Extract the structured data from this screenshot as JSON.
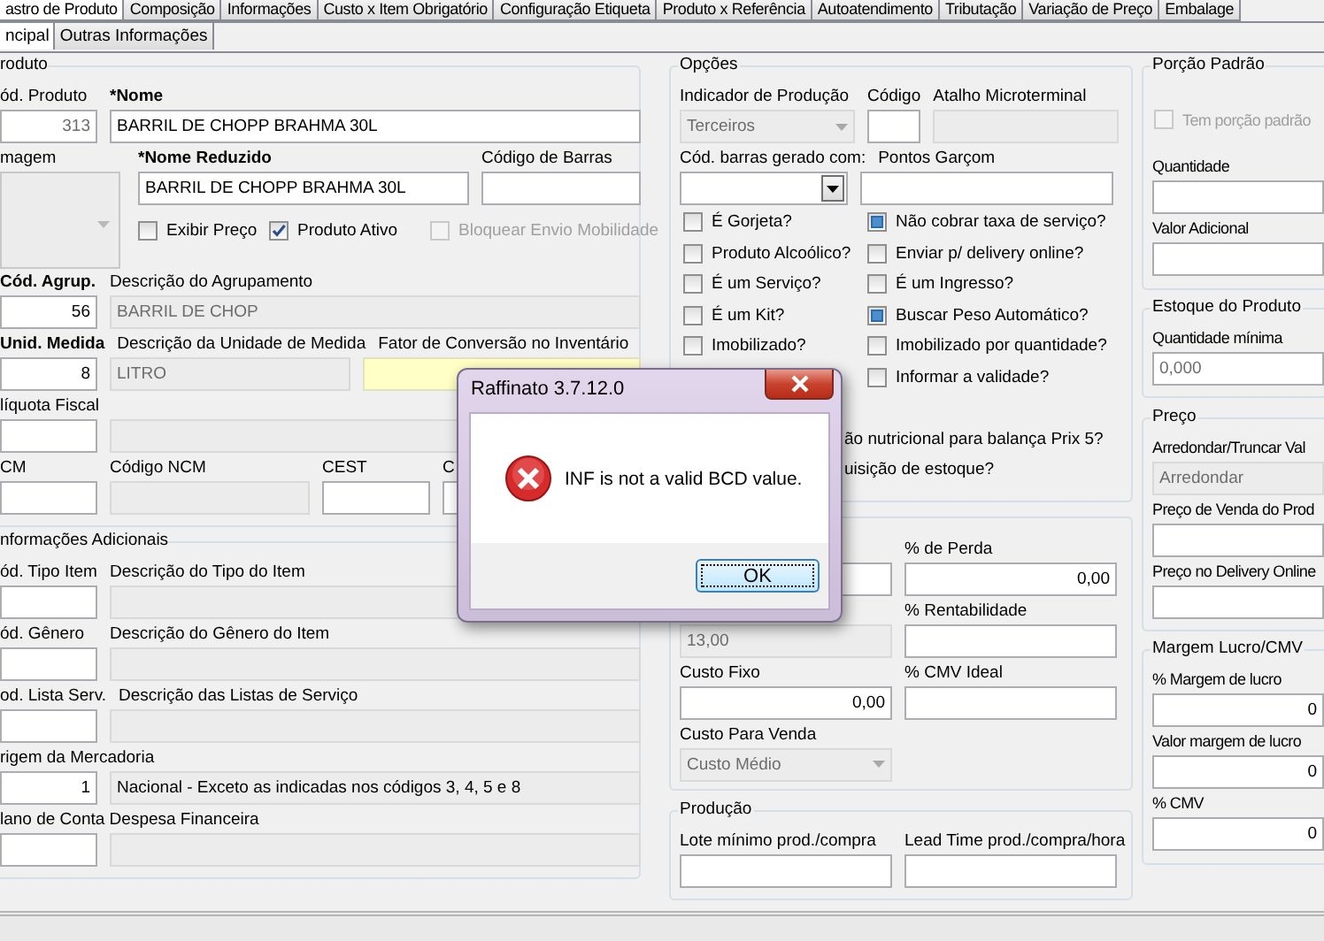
{
  "tabs": [
    {
      "label": "astro de Produto",
      "selected": true
    },
    {
      "label": "Composição",
      "selected": false
    },
    {
      "label": "Informações",
      "selected": false
    },
    {
      "label": "Custo x Item Obrigatório",
      "selected": false
    },
    {
      "label": "Configuração Etiqueta",
      "selected": false
    },
    {
      "label": "Produto x Referência",
      "selected": false
    },
    {
      "label": "Autoatendimento",
      "selected": false
    },
    {
      "label": "Tributação",
      "selected": false
    },
    {
      "label": "Variação de Preço",
      "selected": false
    },
    {
      "label": "Embalage",
      "selected": false
    }
  ],
  "subtabs": [
    {
      "label": "ncipal",
      "selected": true
    },
    {
      "label": "Outras Informações",
      "selected": false
    }
  ],
  "produto": {
    "title": "roduto",
    "cod": {
      "label": "ód. Produto",
      "value": "313"
    },
    "nome": {
      "label": "*Nome",
      "value": "BARRIL DE CHOPP BRAHMA 30L",
      "required": true
    },
    "imagem": {
      "label": "magem"
    },
    "nome_reduzido": {
      "label": "*Nome Reduzido",
      "value": "BARRIL DE CHOPP BRAHMA 30L",
      "required": true
    },
    "codigo_barras": {
      "label": "Código de Barras"
    },
    "checks": [
      {
        "label": "Exibir Preço",
        "checked": false,
        "disabled": false
      },
      {
        "label": "Produto Ativo",
        "checked": true,
        "disabled": false
      },
      {
        "label": "Bloquear Envio Mobilidade",
        "checked": false,
        "disabled": true
      }
    ],
    "agrup": {
      "label": "Cód. Agrup.",
      "value": "56",
      "required": true
    },
    "agrup_desc": {
      "label": "Descrição do Agrupamento",
      "value": "BARRIL DE CHOP",
      "disabled": true
    },
    "unid": {
      "label": "Unid. Medida",
      "value": "8",
      "required": true
    },
    "unid_desc": {
      "label": "Descrição da Unidade de Medida",
      "value": "LITRO",
      "disabled": true
    },
    "fator": {
      "label": "Fator de Conversão no Inventário",
      "highlighted": true
    },
    "aliquota": {
      "label": "líquota Fiscal"
    },
    "aliquota_desc": {
      "disabled": true
    },
    "ncm": [
      {
        "label": "CM",
        "disabled": false
      },
      {
        "label": "Código NCM",
        "disabled": true
      },
      {
        "label": "CEST",
        "disabled": false
      },
      {
        "label": "C",
        "disabled": false
      }
    ]
  },
  "adicionais": {
    "title": "nformações Adicionais",
    "rows": [
      {
        "code_label": "ód. Tipo Item",
        "desc_label": "Descrição do Tipo do Item"
      },
      {
        "code_label": "ód. Gênero",
        "desc_label": "Descrição do Gênero do Item"
      },
      {
        "code_label": "od. Lista Serv.",
        "desc_label": "Descrição das Listas de Serviço"
      },
      {
        "code_label": "rigem da Mercadoria",
        "code": "1",
        "desc": "Nacional - Exceto as indicadas nos códigos 3, 4, 5 e 8"
      },
      {
        "code_label": "lano de Conta Despesa Financeira"
      }
    ]
  },
  "opcoes": {
    "title": "Opções",
    "indicador": {
      "label": "Indicador de Produção",
      "value": "Terceiros",
      "disabled": true
    },
    "codigo": {
      "label": "Código"
    },
    "atalho": {
      "label": "Atalho Microterminal",
      "disabled": true
    },
    "cod_barras": {
      "label": "Cód. barras gerado com:"
    },
    "pontos": {
      "label": "Pontos Garçom"
    },
    "left": [
      {
        "label": "É Gorjeta?",
        "checked": false
      },
      {
        "label": "Produto Alcoólico?",
        "checked": false
      },
      {
        "label": "É um Serviço?",
        "checked": false
      },
      {
        "label": "É um Kit?",
        "checked": false
      },
      {
        "label": "Imobilizado?",
        "checked": false
      }
    ],
    "right": [
      {
        "label": "Não cobrar taxa de serviço?",
        "checked": false,
        "indeterminate": true
      },
      {
        "label": "Enviar p/ delivery online?",
        "checked": false,
        "indeterminate": false
      },
      {
        "label": "É um Ingresso?",
        "checked": false,
        "indeterminate": false
      },
      {
        "label": "Buscar Peso Automático?",
        "checked": false,
        "indeterminate": true
      },
      {
        "label": "Imobilizado por quantidade?",
        "checked": false,
        "indeterminate": false
      },
      {
        "label": "Informar a validade?",
        "checked": false,
        "indeterminate": false
      }
    ],
    "partial": [
      "ão nutricional para balança Prix 5?",
      "uisição de estoque?"
    ]
  },
  "custos": {
    "perda": {
      "label": "% de Perda",
      "value": "0,00"
    },
    "custo_a": {
      "value": "13,00",
      "disabled": true
    },
    "rentab": {
      "label": "% Rentabilidade"
    },
    "custo_fixo": {
      "label": "Custo Fixo",
      "value": "0,00"
    },
    "cmv_ideal": {
      "label": "% CMV Ideal"
    },
    "custo_venda": {
      "label": "Custo Para Venda",
      "value": "Custo Médio",
      "disabled": true
    }
  },
  "producao": {
    "title": "Produção",
    "lote": {
      "label": "Lote mínimo prod./compra"
    },
    "lead": {
      "label": "Lead Time prod./compra/hora"
    }
  },
  "porcao": {
    "title": "Porção Padrão",
    "check": {
      "label": "Tem porção padrão",
      "checked": false,
      "disabled": true
    },
    "quantidade": {
      "label": "Quantidade"
    },
    "valor": {
      "label": "Valor Adicional"
    }
  },
  "estoque": {
    "title": "Estoque do Produto",
    "minima": {
      "label": "Quantidade mínima",
      "value": "0,000"
    }
  },
  "preco": {
    "title": "Preço",
    "arredondar": {
      "label": "Arredondar/Truncar Val",
      "value": "Arredondar",
      "disabled": true
    },
    "venda": {
      "label": "Preço de Venda do Prod"
    },
    "delivery": {
      "label": "Preço no Delivery Online"
    }
  },
  "margem": {
    "title": "Margem Lucro/CMV",
    "margem": {
      "label": "% Margem de lucro",
      "value": "0"
    },
    "valor": {
      "label": "Valor margem de lucro",
      "value": "0"
    },
    "cmv": {
      "label": "% CMV",
      "value": "0"
    }
  },
  "dialog": {
    "title": "Raffinato 3.7.12.0",
    "message": "INF is not a valid BCD value.",
    "button": "OK"
  }
}
